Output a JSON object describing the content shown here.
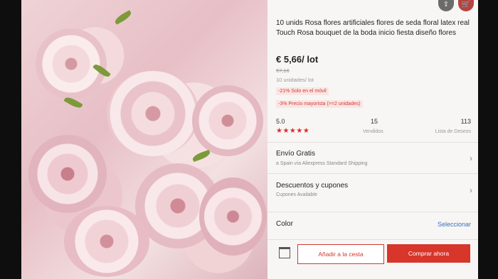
{
  "product": {
    "title": "10 unids Rosa flores artificiales flores de seda floral latex real Touch Rosa bouquet de la boda inicio fiesta diseño flores",
    "price": "€ 5,66/ lot",
    "old_price": "€7,16",
    "units": "10 unidades/ lot",
    "promo_mobile": "-21% Solo en el móvil",
    "promo_wholesale": "-3% Precio mayorista (>=2 unidades)"
  },
  "stats": {
    "rating": "5.0",
    "stars": "★★★★★",
    "sold_count": "15",
    "sold_label": "Vendidos",
    "wishlist_count": "113",
    "wishlist_label": "Lista de Deseos"
  },
  "shipping": {
    "title": "Envío Gratis",
    "subtitle": "a Spain vía Aliexpress Standard Shipping"
  },
  "coupons": {
    "title": "Descuentos y cupones",
    "subtitle": "Cupones Available"
  },
  "color": {
    "label": "Color",
    "action": "Seleccionar"
  },
  "bottom": {
    "add_to_cart": "Añadir a la cesta",
    "buy_now": "Comprar ahora"
  },
  "icons": {
    "share": "share-icon",
    "cart": "cart-icon",
    "store": "store-icon",
    "chevron": "›"
  },
  "colors": {
    "accent": "#d8352b",
    "link": "#3f6fb6"
  }
}
